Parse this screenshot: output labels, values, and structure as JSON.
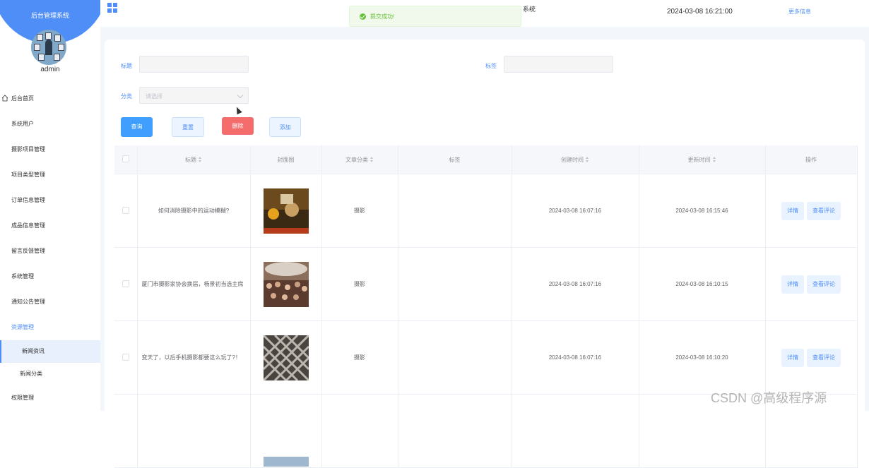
{
  "sidebar": {
    "title": "后台管理系统",
    "username": "admin",
    "items": [
      {
        "label": "后台首页"
      },
      {
        "label": "系统用户"
      },
      {
        "label": "摄影项目管理"
      },
      {
        "label": "项目类型管理"
      },
      {
        "label": "订单信息管理"
      },
      {
        "label": "成品信息管理"
      },
      {
        "label": "留言反馈管理"
      },
      {
        "label": "系统管理"
      },
      {
        "label": "通知公告管理"
      },
      {
        "label": "资源管理"
      },
      {
        "label": "新闻资讯"
      },
      {
        "label": "新闻分类"
      },
      {
        "label": "权限管理"
      }
    ]
  },
  "header": {
    "system_name": "系统",
    "datetime": "2024-03-08 16:21:00",
    "more_info": "更多信息",
    "toast": "提交成功!"
  },
  "filters": {
    "title_label": "标题",
    "tag_label": "标签",
    "category_label": "分类",
    "category_placeholder": "请选择"
  },
  "buttons": {
    "query": "查询",
    "reset": "重置",
    "delete": "删除",
    "add": "添加"
  },
  "table": {
    "columns": [
      "标题",
      "封面图",
      "文章分类",
      "标签",
      "创建时间",
      "更新时间",
      "操作"
    ],
    "rows": [
      {
        "title": "如何消除摄影中的运动模糊?",
        "category": "摄影",
        "tag": "",
        "created": "2024-03-08 16:07:16",
        "updated": "2024-03-08 16:15:46"
      },
      {
        "title": "厦门市摄影家协会换届，杨景初当选主席",
        "category": "摄影",
        "tag": "",
        "created": "2024-03-08 16:07:16",
        "updated": "2024-03-08 16:10:15"
      },
      {
        "title": "变天了，以后手机摄影都要这么玩了?！",
        "category": "摄影",
        "tag": "",
        "created": "2024-03-08 16:07:16",
        "updated": "2024-03-08 16:10:20"
      }
    ],
    "actions": {
      "detail": "详情",
      "comments": "查看评论"
    }
  },
  "watermark": "CSDN @高级程序源",
  "colors": {
    "primary": "#409eff",
    "danger": "#f56c6c",
    "success": "#67c23a"
  }
}
